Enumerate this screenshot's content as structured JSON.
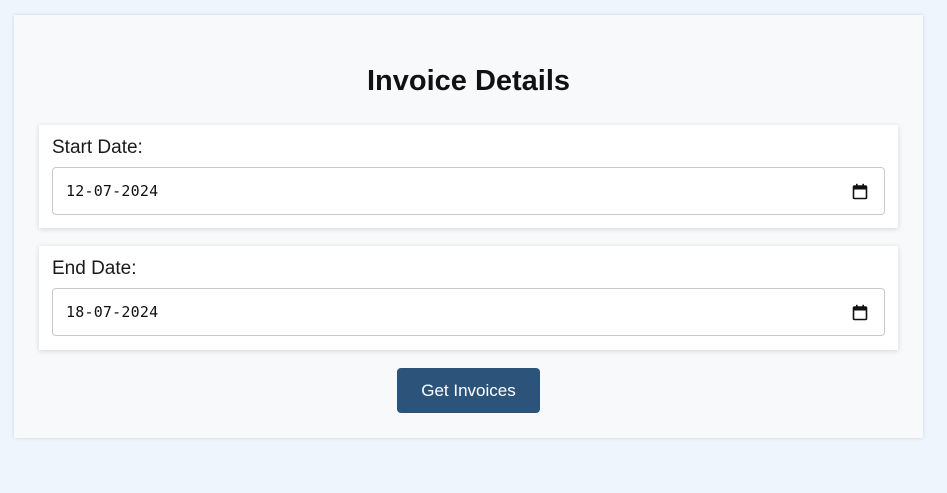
{
  "form": {
    "title": "Invoice Details",
    "start_date": {
      "label": "Start Date:",
      "value": "12-07-2024",
      "icon": "calendar-icon"
    },
    "end_date": {
      "label": "End Date:",
      "value": "18-07-2024",
      "icon": "calendar-icon"
    },
    "submit_label": "Get Invoices"
  },
  "colors": {
    "page_background": "#eef5fd",
    "card_background": "#f7f9fb",
    "button_background": "#2c5379",
    "button_text": "#ffffff"
  }
}
